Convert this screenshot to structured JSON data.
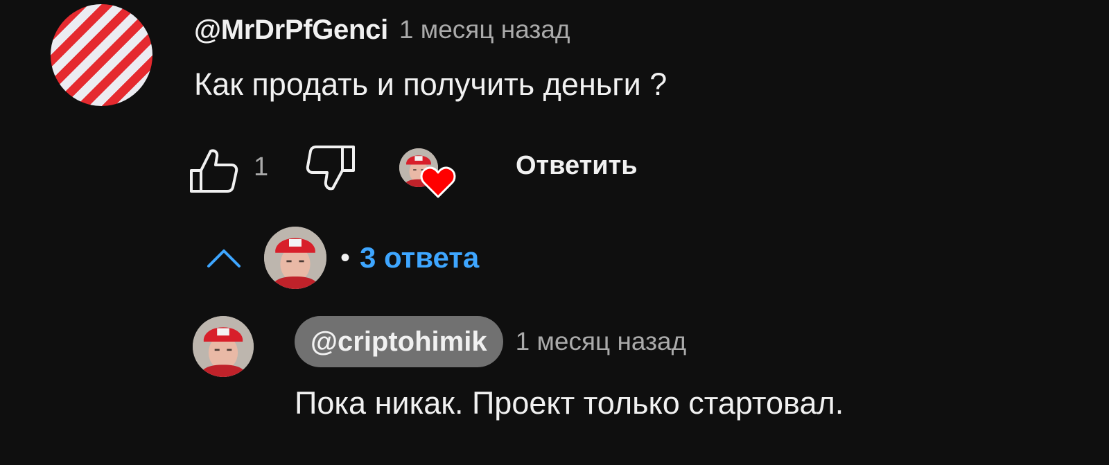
{
  "comment": {
    "author": "@MrDrPfGenci",
    "timestamp": "1 месяц назад",
    "text": "Как продать и получить деньги ?",
    "avatar_style": "red-white-diagonal-stripes",
    "colors": {
      "stripe_red": "#e52a2f",
      "stripe_white": "#ececf2"
    }
  },
  "actions": {
    "like_icon": "thumbs-up-icon",
    "like_count": "1",
    "dislike_icon": "thumbs-down-icon",
    "creator_heart_icon": "heart-icon",
    "heart_color": "#ff0000",
    "reply_label": "Ответить"
  },
  "replies_toggle": {
    "icon": "chevron-up-icon",
    "separator": "•",
    "count_label": "3 ответа",
    "accent_color": "#3ea6ff"
  },
  "reply": {
    "author": "@criptohimik",
    "timestamp": "1 месяц назад",
    "text": "Пока никак. Проект только стартовал."
  }
}
